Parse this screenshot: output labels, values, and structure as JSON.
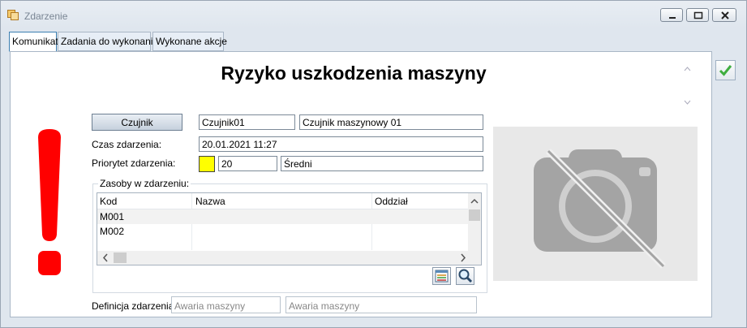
{
  "window": {
    "title": "Zdarzenie"
  },
  "tabs": [
    {
      "label": "Komunikat",
      "active": true
    },
    {
      "label": "Zadania do wykonania",
      "active": false
    },
    {
      "label": "Wykonane akcje",
      "active": false
    }
  ],
  "heading": "Ryzyko uszkodzenia maszyny",
  "sensor": {
    "button_label": "Czujnik",
    "code": "Czujnik01",
    "name": "Czujnik maszynowy 01"
  },
  "event_time": {
    "label": "Czas zdarzenia:",
    "value": "20.01.2021 11:27"
  },
  "priority": {
    "label": "Priorytet zdarzenia:",
    "color": "#ffff00",
    "value": "20",
    "name": "Średni"
  },
  "resources": {
    "title": "Zasoby w zdarzeniu:",
    "columns": [
      "Kod",
      "Nazwa",
      "Oddział"
    ],
    "rows": [
      {
        "kod": "M001",
        "nazwa": "",
        "oddzial": ""
      },
      {
        "kod": "M002",
        "nazwa": "",
        "oddzial": ""
      }
    ]
  },
  "definition": {
    "label": "Definicja zdarzenia:",
    "code": "Awaria maszyny",
    "name": "Awaria maszyny"
  },
  "colors": {
    "alert": "#ff0000",
    "ok_check": "#3fae3f",
    "accent": "#3c7fb1"
  },
  "icons": [
    "app-icon",
    "minimize-icon",
    "maximize-icon",
    "close-icon",
    "checkmark-icon",
    "exclamation-icon",
    "list-icon",
    "magnifier-icon",
    "no-photo-icon"
  ]
}
